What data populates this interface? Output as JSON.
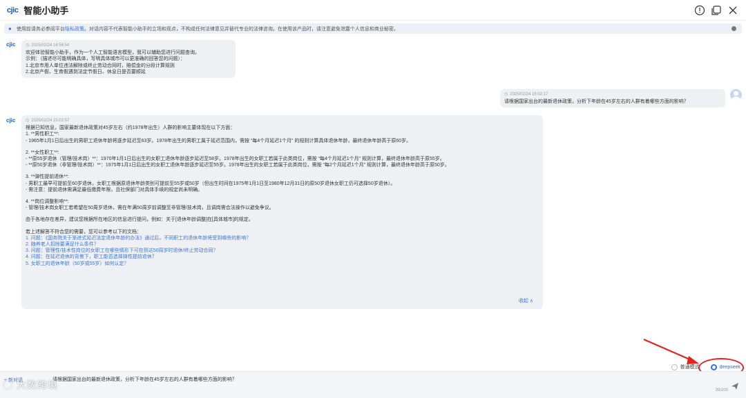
{
  "header": {
    "logo": "cjic",
    "title": "智能小助手"
  },
  "notice": {
    "prefix": "使用前请务必参阅平台",
    "link": "隐私政策",
    "suffix": "。对话内容不代表智能小助手的立场和观点，不构成任何法律意见并替代专业的法律咨询。在使用该产品时，请注意避免泄露个人信息和商业秘密。"
  },
  "bot": {
    "avatar": "cjic"
  },
  "welcome": {
    "timestamp": "2025/02/24 14:56:54",
    "lines": [
      "欢迎体验智能小助手，作为一个人工智能语言模型，我可以辅助您进行问题查询。",
      "示例：（描述尽可能明确具体，写明具体城市可以更准确的回答您的问题）：",
      "1.北京市用人单位违法解除或终止劳动合同时，赔偿金的分段计算规则",
      "2.北京产假、生育假遇到法定节假日、休息日是否要顺延"
    ]
  },
  "user_message": {
    "timestamp": "2025/02/24 15:02:17",
    "text": "请根据国家出台的最新退休政策，分析下年龄在45岁左右的人群有着哪些方面的影响？"
  },
  "answer": {
    "timestamp": "2025/02/24 15:02:57",
    "intro": "根据已知信息，国家最新退休政策对45岁左右（约1978年出生）人群的影响主要体现在以下方面：",
    "s1_title": "1. **男性职工**:",
    "s1_l1": "- 1965年1月1日后出生的男职工退休年龄将逐步延迟至63岁。1978年出生的男职工属于延迟范围内，需按 “每4个月延迟1个月” 的规则计算具体退休年龄，最终退休年龄高于原60岁。",
    "s2_title": "2. **女性职工**:",
    "s2_l1": "- **原55岁退休（管理/技术岗）**：1970年1月1日后出生的女职工退休年龄逐步延迟至58岁。1978年出生的女职工若属于此类岗位，需按 “每4个月延迟1个月” 规则计算，最终退休年龄高于原55岁。",
    "s2_l2": "- **原50岁退休（非管理/技术岗）**：1975年1月1日后出生的女职工退休年龄逐步延迟至55岁。1978年出生的女职工若属于此类岗位，需按 “每2个月延迟1个月” 规则计算，最终退休年龄高于原50岁。",
    "s3_title": "3. **弹性提前退休**:",
    "s3_l1": "- 男职工最早可提前至60岁退休，女职工根据原退休年龄类别可提前至55岁或50岁（但出生时间在1975年1月1日至1980年12月31日的原50岁退休女职工仍可选择50岁退休）。",
    "s3_l2": "- 需注意：提前退休需满足最低缴费年限，且社保部门对具体手续的规定尚未明确。",
    "s4_title": "4. **岗位调整影响**:",
    "s4_l1": "- 管理/技术岗女职工若希望在50周岁退休，需在年满50周岁前调整至非管理/技术岗，且调岗需合法操作以避免争议。",
    "advice": "由于各地存在差异，建议您根据所在地区的信息进行提问，例如：关于[退休年龄调整]在[具体城市]的规定。",
    "ref_intro": "若上述解答不符合您的需要，您可以参考以下的文档：",
    "refs": [
      "1. 问题：《国务院关于渐进式延迟法定退休年龄的办法》通过后，不同职工的退休年龄将受到哪些的影响？",
      "2. 随养老人扣除要满足什么条件？",
      "3. 问题：管理性/技术性岗位的女职工在哪些情形下可在到达50周岁时退休/终止劳动合同？",
      "4. 问题：在延迟退休的背景下，职工能否选择弹性提前退休？",
      "5. 女职工的退休年龄（50岁或55岁）如何认定？"
    ],
    "collapse": "收起 ∧"
  },
  "modes": {
    "normal": "普通模式",
    "deep": "deepseek",
    "selected": "deepseek"
  },
  "input": {
    "new_chat": "+ 新对话",
    "text": "请根据国家出台的最新退休政策，分析下年龄在45岁左右的人群有着哪些方面的影响？",
    "counter": "39/200"
  },
  "watermark": "大数跨境",
  "colors": {
    "accent": "#2d6fe6",
    "annotation": "#e32222",
    "bubble": "#eef0f4"
  }
}
